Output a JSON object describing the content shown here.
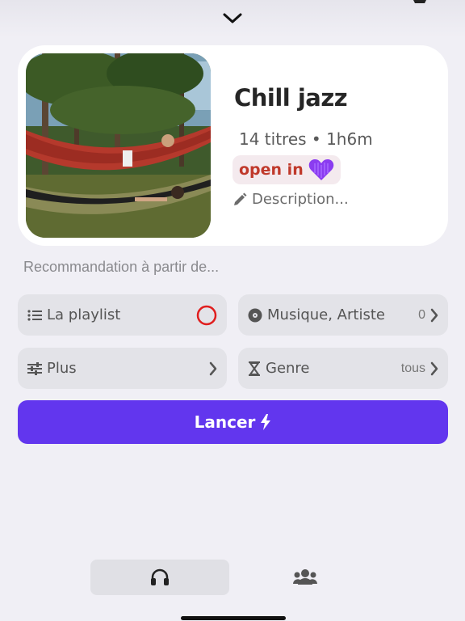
{
  "header": {
    "collapse_icon": "chevron-down-icon",
    "corner_icon": "partial-icon"
  },
  "playlist": {
    "title": "Chill jazz",
    "meta": "14 titres • 1h6m",
    "open_in_label": "open in",
    "open_in_icon": "purple-heart-icon",
    "description_label": "Description...",
    "description_icon": "pencil-icon"
  },
  "recommendation": {
    "label": "Recommandation à partir de...",
    "options": [
      {
        "label": "La playlist",
        "icon": "list-icon",
        "status": "red-circle"
      },
      {
        "label": "Musique, Artiste",
        "icon": "vinyl-icon",
        "value": "0"
      },
      {
        "label": "Plus",
        "icon": "sliders-icon"
      },
      {
        "label": "Genre",
        "icon": "hourglass-icon",
        "value": "tous"
      }
    ]
  },
  "launch": {
    "label": "Lancer",
    "icon": "bolt-icon"
  },
  "tabs": [
    {
      "icon": "headphones-icon",
      "active": true
    },
    {
      "icon": "users-icon",
      "active": false
    }
  ],
  "colors": {
    "accent": "#6236ee",
    "open_in_text": "#c0392b",
    "heart": "#8b3cf0",
    "status_circle": "#e01e1e"
  }
}
